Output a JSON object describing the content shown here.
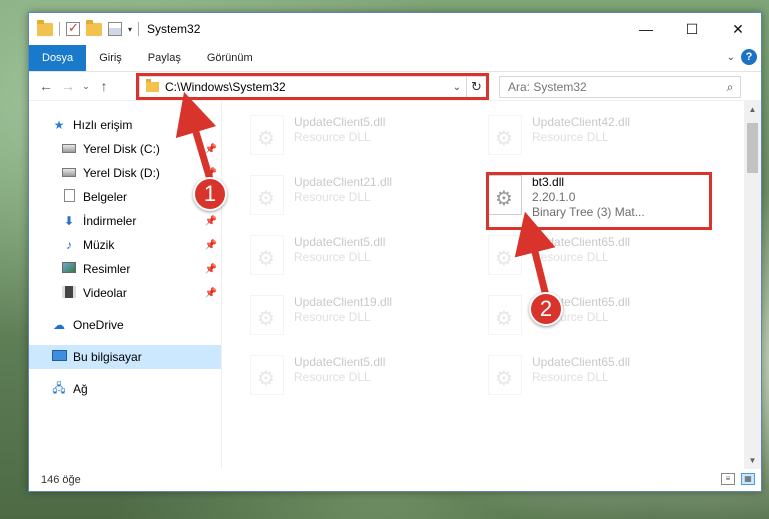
{
  "window": {
    "title": "System32",
    "controls": {
      "minimize": "—",
      "maximize": "☐",
      "close": "✕"
    }
  },
  "ribbon": {
    "tabs": [
      "Dosya",
      "Giriş",
      "Paylaş",
      "Görünüm"
    ],
    "help": "?"
  },
  "nav": {
    "address": "C:\\Windows\\System32",
    "search_placeholder": "Ara: System32"
  },
  "sidebar": {
    "items": [
      {
        "label": "Hızlı erişim"
      },
      {
        "label": "Yerel Disk (C:)"
      },
      {
        "label": "Yerel Disk (D:)"
      },
      {
        "label": "Belgeler"
      },
      {
        "label": "İndirmeler"
      },
      {
        "label": "Müzik"
      },
      {
        "label": "Resimler"
      },
      {
        "label": "Videolar"
      },
      {
        "label": "OneDrive"
      },
      {
        "label": "Bu bilgisayar"
      },
      {
        "label": "Ağ"
      }
    ]
  },
  "files": {
    "col1": [
      {
        "name": "UpdateClient5.dll",
        "type": "Resource DLL"
      },
      {
        "name": "UpdateClient21.dll",
        "type": "Resource DLL"
      },
      {
        "name": "UpdateClient5.dll",
        "type": "Resource DLL"
      },
      {
        "name": "UpdateClient19.dll",
        "type": "Resource DLL"
      },
      {
        "name": "UpdateClient5.dll",
        "type": "Resource DLL"
      }
    ],
    "col2": [
      {
        "name": "UpdateClient42.dll",
        "type": "Resource DLL"
      },
      {
        "name": "UpdateClient65.dll",
        "type": "Resource DLL"
      },
      {
        "name": "UpdateClient65.dll",
        "type": "Resource DLL"
      },
      {
        "name": "UpdateClient65.dll",
        "type": "Resource DLL"
      }
    ],
    "highlighted": {
      "name": "bt3.dll",
      "version": "2.20.1.0",
      "description": "Binary Tree (3) Mat..."
    }
  },
  "status": {
    "count": "146 öğe"
  },
  "annotations": {
    "step1": "1",
    "step2": "2",
    "color": "#d9342b"
  }
}
